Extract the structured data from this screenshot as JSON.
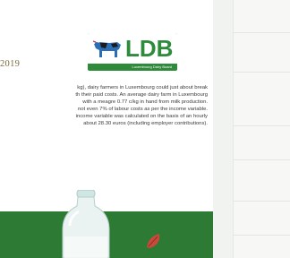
{
  "logo": {
    "text": "LDB",
    "subtitle": "Luxembourg Dairy Board",
    "icon": "cow-icon"
  },
  "article": {
    "year": "2019",
    "lines": [
      "kg), dairy farmers in Luxembourg could just about break",
      "th their paid costs. An average dairy farm in Luxembourg",
      "with a meagre 0.77 c/kg in hand from milk production.",
      "not even 7% of labour costs as per the income variable.",
      "income variable was calculated on the basis of an hourly",
      "about 28.30 euros (including employer contributions)."
    ]
  },
  "illustration": {
    "items": [
      "milk-bottle-icon",
      "leaf-icon"
    ]
  },
  "colors": {
    "brand_green": "#2e8b3b",
    "band_green": "#2c7a33",
    "year_text": "#7a6a3d",
    "body_text": "#3a3a3a"
  }
}
